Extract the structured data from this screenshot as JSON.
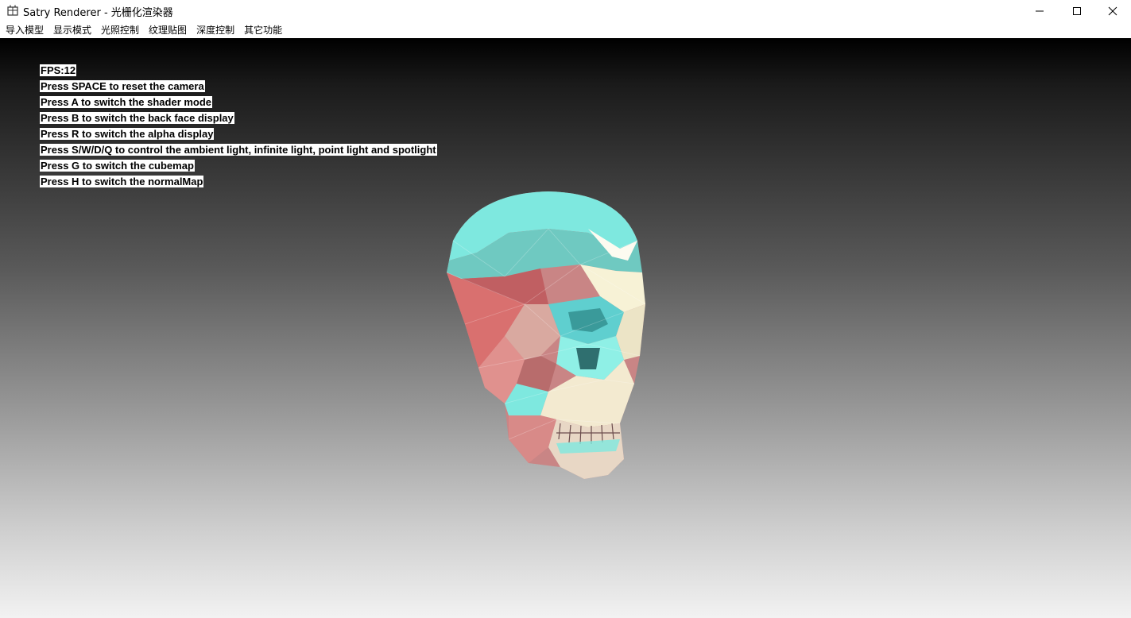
{
  "window": {
    "title": "Satry Renderer - 光栅化渲染器",
    "icon": "app-icon",
    "controls": [
      "minimize-icon",
      "maximize-icon",
      "close-icon"
    ]
  },
  "menu": {
    "items": [
      {
        "label": "导入模型"
      },
      {
        "label": "显示模式"
      },
      {
        "label": "光照控制"
      },
      {
        "label": "纹理贴图"
      },
      {
        "label": "深度控制"
      },
      {
        "label": "其它功能"
      }
    ]
  },
  "hud": {
    "lines": [
      "FPS:12",
      "Press SPACE to reset the camera",
      "Press A to switch the shader mode",
      "Press B to switch the back face display",
      "Press R to switch the alpha display",
      "Press S/W/D/Q to control the ambient light, infinite light, point light and spotlight",
      "Press G to switch the cubemap",
      "Press H to switch the normalMap"
    ]
  },
  "scene": {
    "model": "skull",
    "background_top": "#000000",
    "background_bottom": "#f2f2f2",
    "colors": [
      "#7ee8df",
      "#d9706f",
      "#f7f2d6",
      "#5fcfcf"
    ]
  }
}
